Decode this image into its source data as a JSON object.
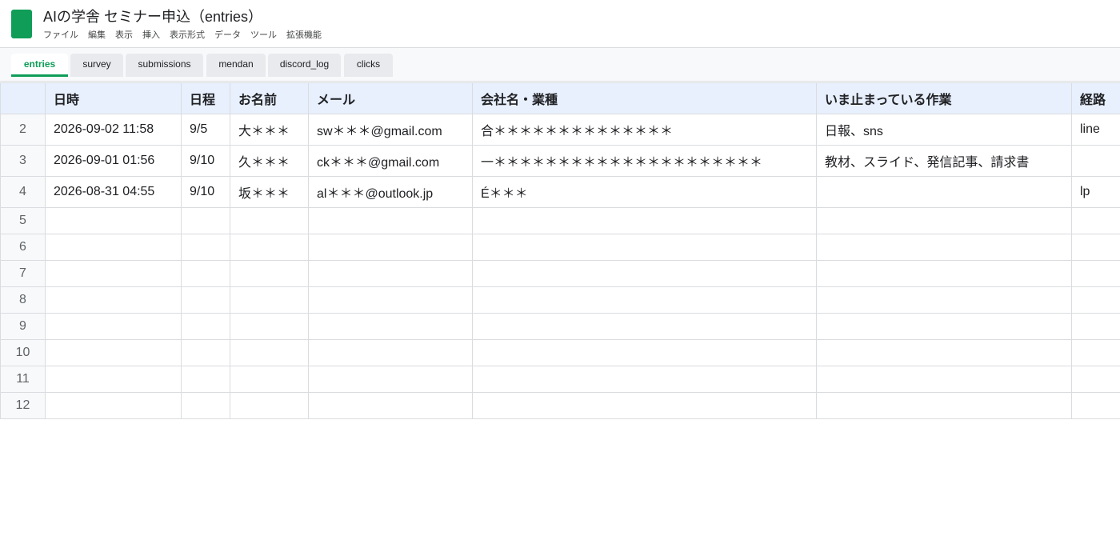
{
  "app": {
    "title": "AIの学舎 セミナー申込（entries）",
    "accent_color": "#0f9d58",
    "icon": "sheets-app-icon"
  },
  "menu": [
    "ファイル",
    "編集",
    "表示",
    "挿入",
    "表示形式",
    "データ",
    "ツール",
    "拡張機能"
  ],
  "tabs": [
    {
      "label": "entries",
      "active": true
    },
    {
      "label": "survey",
      "active": false
    },
    {
      "label": "submissions",
      "active": false
    },
    {
      "label": "mendan",
      "active": false
    },
    {
      "label": "discord_log",
      "active": false
    },
    {
      "label": "clicks",
      "active": false
    }
  ],
  "table": {
    "headers": [
      "日時",
      "日程",
      "お名前",
      "メール",
      "会社名・業種",
      "いま止まっている作業",
      "経路"
    ],
    "rows": [
      {
        "num": "2",
        "cells": [
          "2026-09-02 11:58",
          "9/5",
          "大＊＊＊",
          "sw＊＊＊@gmail.com",
          "合＊＊＊＊＊＊＊＊＊＊＊＊＊＊",
          "日報、sns",
          "line"
        ]
      },
      {
        "num": "3",
        "cells": [
          "2026-09-01 01:56",
          "9/10",
          "久＊＊＊",
          "ck＊＊＊@gmail.com",
          "一＊＊＊＊＊＊＊＊＊＊＊＊＊＊＊＊＊＊＊＊＊",
          "教材、スライド、発信記事、請求書",
          ""
        ]
      },
      {
        "num": "4",
        "cells": [
          "2026-08-31 04:55",
          "9/10",
          "坂＊＊＊",
          "al＊＊＊@outlook.jp",
          "É＊＊＊",
          "",
          "lp"
        ]
      }
    ],
    "empty_row_numbers": [
      "5",
      "6",
      "7",
      "8",
      "9",
      "10",
      "11",
      "12"
    ]
  }
}
